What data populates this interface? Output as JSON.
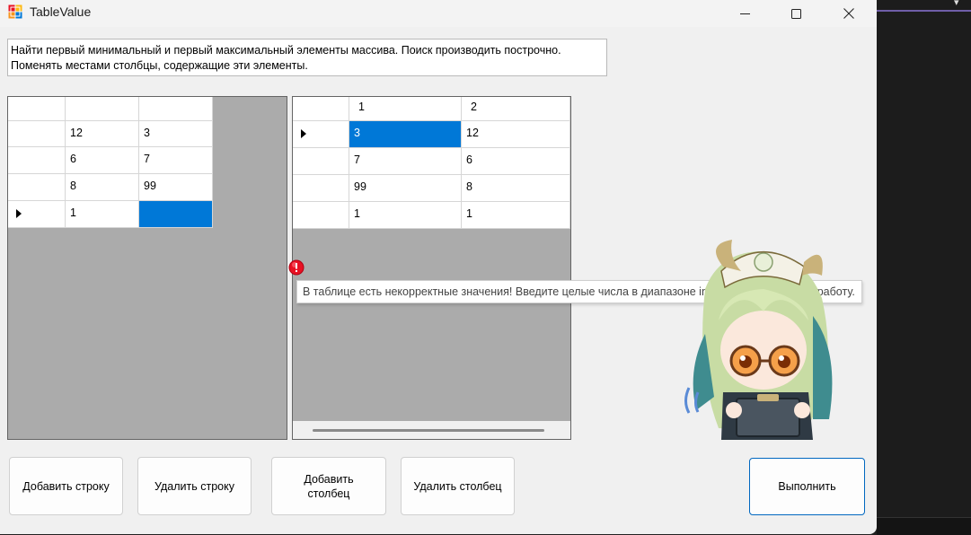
{
  "window": {
    "title": "TableValue"
  },
  "task": {
    "text": "Найти первый минимальный и первый максимальный элементы массива. Поиск производить построчно. Поменять местами столбцы, содержащие эти элементы."
  },
  "grid_left": {
    "headers": [
      "",
      ""
    ],
    "rows": [
      {
        "cells": [
          "12",
          "3"
        ],
        "current": false
      },
      {
        "cells": [
          "6",
          "7"
        ],
        "current": false
      },
      {
        "cells": [
          "8",
          "99"
        ],
        "current": false
      },
      {
        "cells": [
          "1",
          ""
        ],
        "current": true
      }
    ]
  },
  "grid_right": {
    "headers": [
      "1",
      "2"
    ],
    "rows": [
      {
        "cells": [
          "3",
          "12"
        ],
        "current": true
      },
      {
        "cells": [
          "7",
          "6"
        ],
        "current": false
      },
      {
        "cells": [
          "99",
          "8"
        ],
        "current": false
      },
      {
        "cells": [
          "1",
          "1"
        ],
        "current": false
      }
    ]
  },
  "error": {
    "tooltip": "В таблице есть некорректные значения! Введите целые числа в диапазоне int, чтобы продолжить работу."
  },
  "buttons": {
    "add_row": "Добавить строку",
    "delete_row": "Удалить строку",
    "add_column_line1": "Добавить",
    "add_column_line2": "столбец",
    "delete_column": "Удалить столбец",
    "execute": "Выполнить"
  },
  "icons": {
    "app": "app-icon",
    "minimize": "minimize-icon",
    "maximize": "maximize-icon",
    "close": "close-icon",
    "row_pointer": "row-pointer-icon",
    "error": "error-icon"
  },
  "colors": {
    "selection": "#0078d7",
    "error": "#e81123",
    "grid_background": "#ababab"
  }
}
